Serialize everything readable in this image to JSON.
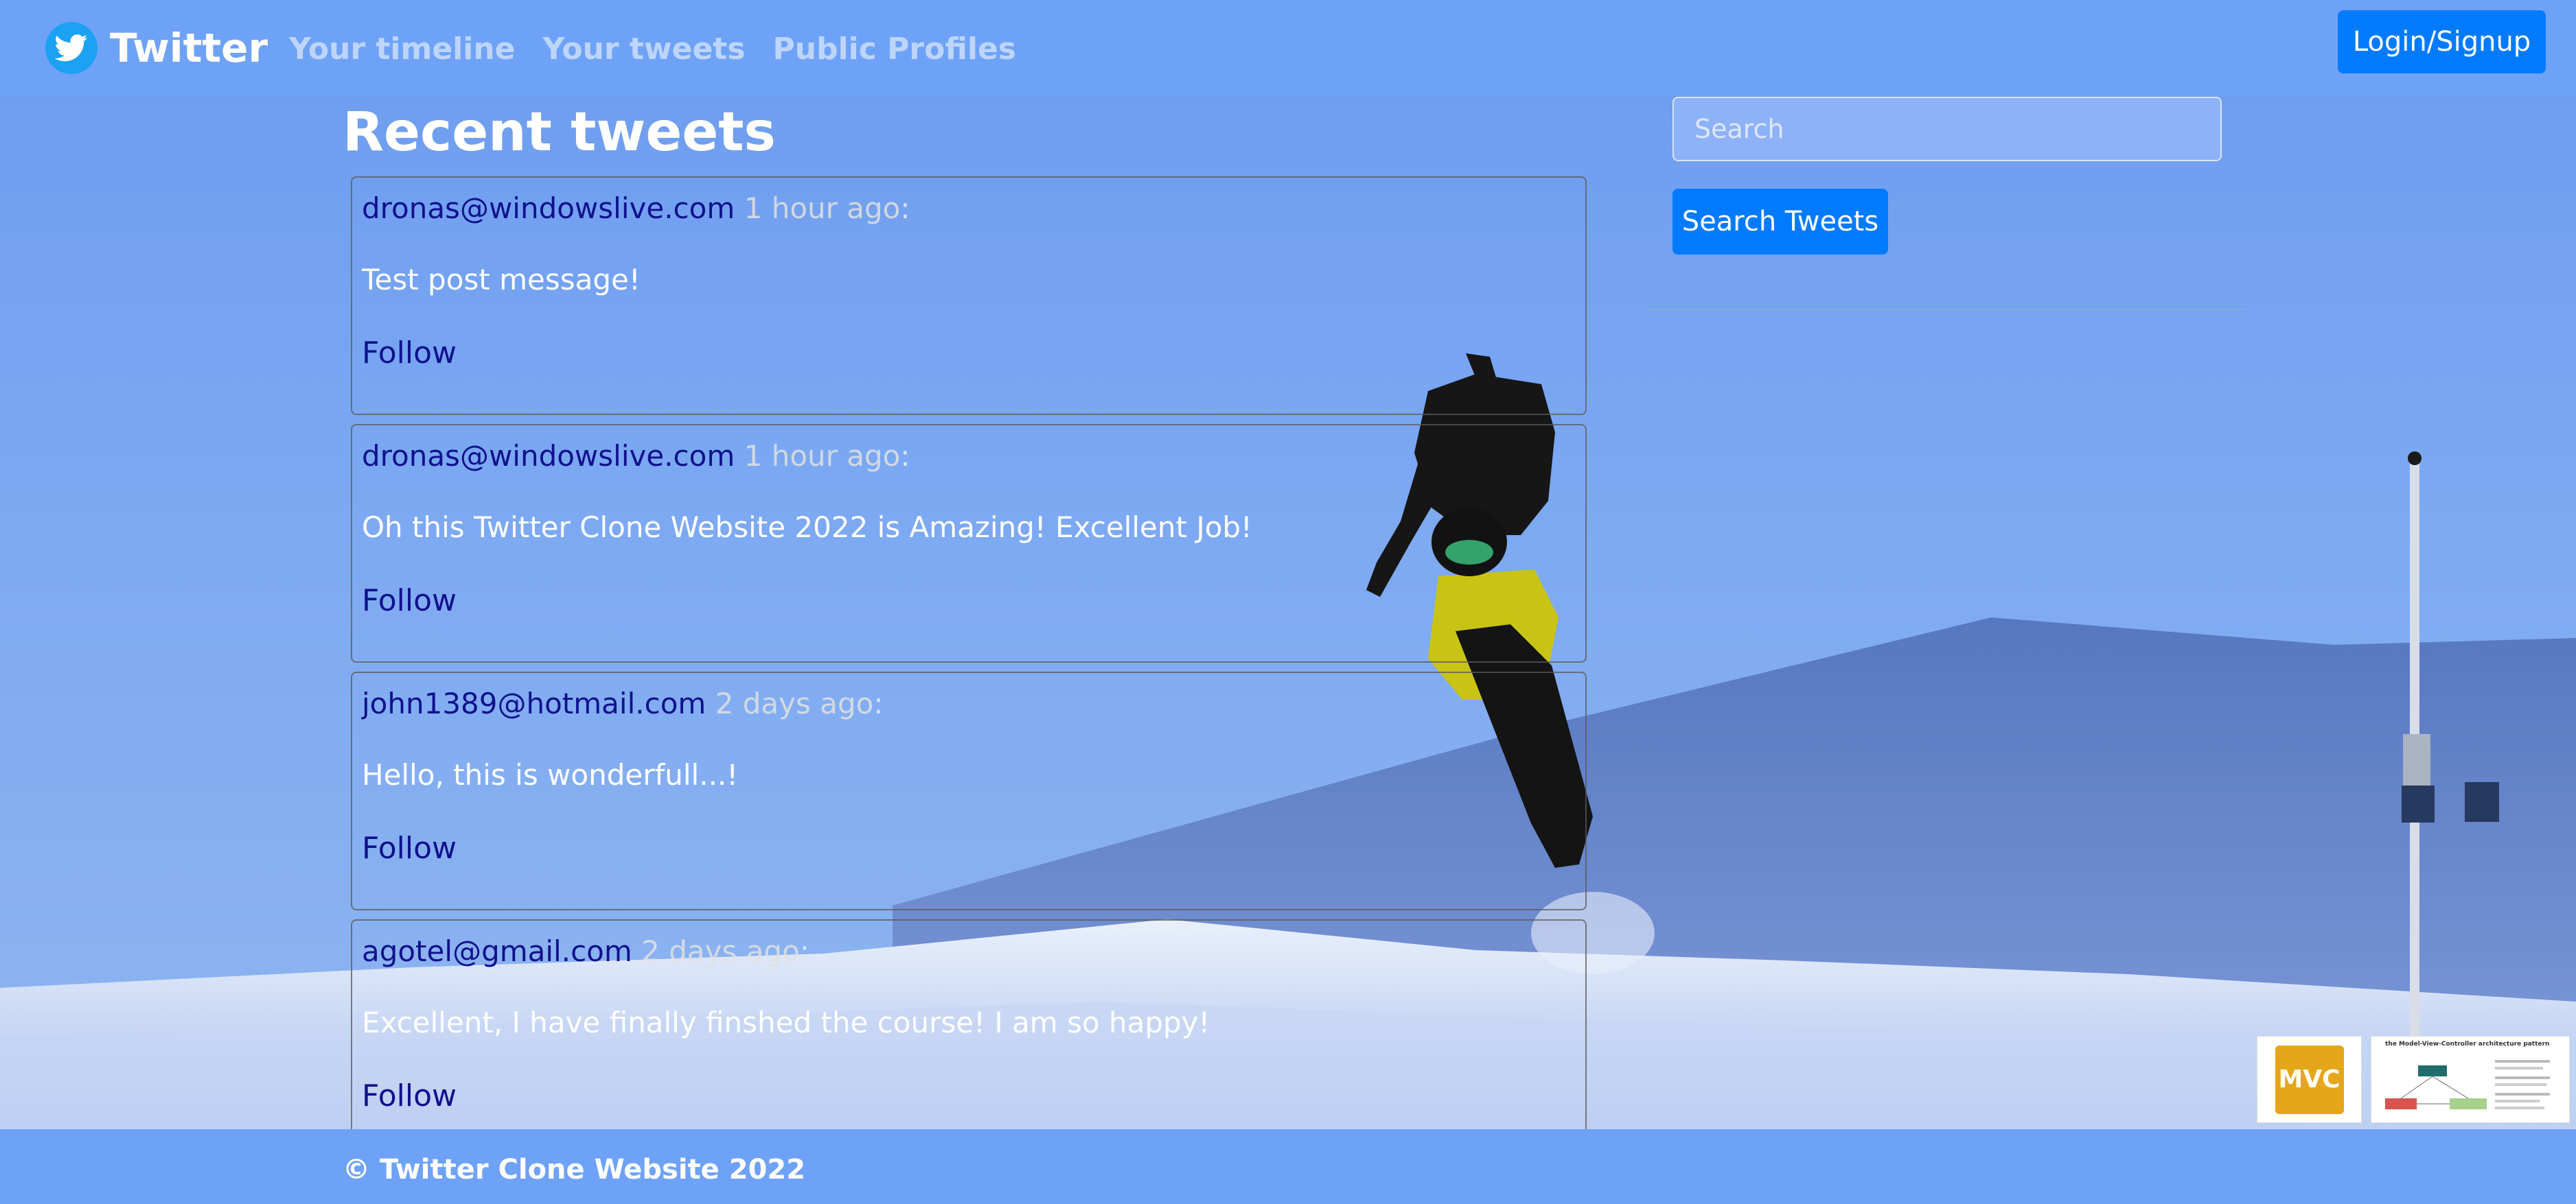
{
  "navbar": {
    "brand": "Twitter",
    "links": [
      "Your timeline",
      "Your tweets",
      "Public Profiles"
    ],
    "login_label": "Login/Signup"
  },
  "main": {
    "title": "Recent tweets",
    "tweets": [
      {
        "author": "dronas@windowslive.com",
        "time": "1 hour ago",
        "body": "Test post message!",
        "follow": "Follow"
      },
      {
        "author": "dronas@windowslive.com",
        "time": "1 hour ago",
        "body": "Oh this Twitter Clone Website 2022 is Amazing! Excellent Job!",
        "follow": "Follow"
      },
      {
        "author": "john1389@hotmail.com",
        "time": "2 days ago",
        "body": "Hello, this is wonderfull...!",
        "follow": "Follow"
      },
      {
        "author": "agotel@gmail.com",
        "time": "2 days ago",
        "body": "Excellent, I have finally finshed the course! I am so happy!",
        "follow": "Follow"
      }
    ]
  },
  "sidebar": {
    "search_placeholder": "Search",
    "search_button": "Search Tweets"
  },
  "footer": {
    "text": "© Twitter Clone Website 2022"
  },
  "thumbnails": {
    "mvc_badge": "MVC",
    "diagram_title": "the Model-View-Controller architecture pattern"
  },
  "colors": {
    "navbar": "#6ea2f7",
    "primary_button": "#007bff",
    "author_link": "#10118c",
    "brand_icon": "#1da1f2"
  },
  "icons": {
    "brand": "twitter-bird-icon"
  }
}
